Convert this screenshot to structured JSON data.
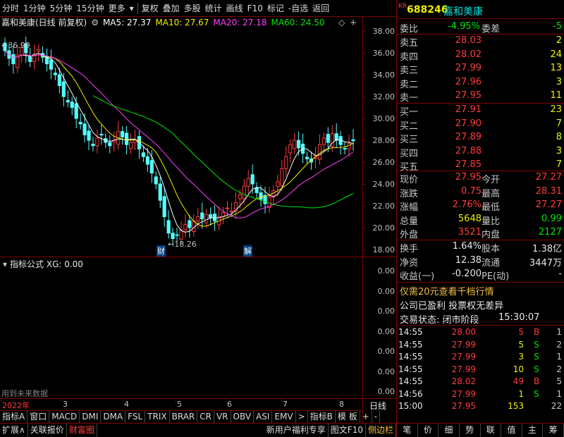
{
  "toolbar": {
    "items": [
      "分时",
      "1分钟",
      "5分钟",
      "15分钟",
      "更多",
      "复权",
      "叠加",
      "多股",
      "统计",
      "画线",
      "F10",
      "标记",
      "-自选",
      "返回"
    ]
  },
  "chart": {
    "title": "嘉和美康(日线 前复权)",
    "ma5": "MA5: 27.37",
    "ma10": "MA10: 27.67",
    "ma20": "MA20: 27.18",
    "ma60": "MA60: 24.50",
    "high_label": "36.99",
    "low_label": "18.26",
    "marker_cai": "财",
    "marker_jie": "解",
    "price_ticks": [
      "38.00",
      "36.00",
      "34.00",
      "32.00",
      "30.00",
      "28.00",
      "26.00",
      "24.00",
      "22.00",
      "20.00",
      "18.00"
    ],
    "indicator_title": "指标公式 XG: 0.00",
    "indicator_ticks": [
      "0.00",
      "0.00",
      "0.00",
      "0.00",
      "0.00",
      "0.00",
      "0.00"
    ],
    "future_data_note": "用到未来数据",
    "x_labels": [
      "2022年",
      "3",
      "4",
      "5",
      "6",
      "7",
      "8"
    ],
    "period_label": "日线",
    "colors": {
      "ma5": "#ffffff",
      "ma10": "#f0f000",
      "ma20": "#ff40ff",
      "ma60": "#00e600",
      "up": "#ff3c3c",
      "down": "#54ffff"
    }
  },
  "index_bar": {
    "items": [
      "指标A",
      "窗口",
      "MACD",
      "DMI",
      "DMA",
      "FSL",
      "TRIX",
      "BRAR",
      "CR",
      "VR",
      "OBV",
      "ASI",
      "EMV"
    ],
    "more": ">",
    "right_items": [
      "指标B",
      "模 板",
      "+",
      "-"
    ]
  },
  "bottom_bar": {
    "items": [
      "扩展∧",
      "关联报价",
      "财富圈"
    ],
    "right_items": [
      "新用户福利专享",
      "图文F10",
      "侧边栏"
    ]
  },
  "quote": {
    "code_prefix": "KR",
    "code": "688246",
    "name": "嘉和美康",
    "weibi_label": "委比",
    "weibi_value": "-4.95%",
    "weicha_label": "委差",
    "weicha_value": "-5",
    "sells": [
      {
        "label": "卖五",
        "price": "28.03",
        "vol": "2"
      },
      {
        "label": "卖四",
        "price": "28.02",
        "vol": "24"
      },
      {
        "label": "卖三",
        "price": "27.99",
        "vol": "13"
      },
      {
        "label": "卖二",
        "price": "27.96",
        "vol": "3"
      },
      {
        "label": "卖一",
        "price": "27.95",
        "vol": "11"
      }
    ],
    "buys": [
      {
        "label": "买一",
        "price": "27.91",
        "vol": "23"
      },
      {
        "label": "买二",
        "price": "27.90",
        "vol": "7"
      },
      {
        "label": "买三",
        "price": "27.89",
        "vol": "8"
      },
      {
        "label": "买四",
        "price": "27.88",
        "vol": "3"
      },
      {
        "label": "买五",
        "price": "27.85",
        "vol": "7"
      }
    ],
    "stats": [
      {
        "l1": "现价",
        "v1": "27.95",
        "l2": "今开",
        "v2": "27.27"
      },
      {
        "l1": "涨跌",
        "v1": "0.75",
        "l2": "最高",
        "v2": "28.31"
      },
      {
        "l1": "涨幅",
        "v1": "2.76%",
        "l2": "最低",
        "v2": "27.27"
      },
      {
        "l1": "总量",
        "v1": "5648",
        "l2": "量比",
        "v2": "0.99"
      },
      {
        "l1": "外盘",
        "v1": "3521",
        "l2": "内盘",
        "v2": "2127"
      }
    ],
    "stats2": [
      {
        "l1": "换手",
        "v1": "1.64%",
        "l2": "股本",
        "v2": "1.38亿"
      },
      {
        "l1": "净资",
        "v1": "12.38",
        "l2": "流通",
        "v2": "3447万"
      },
      {
        "l1": "收益(一)",
        "v1": "-0.200",
        "l2": "PE(动)",
        "v2": "-"
      }
    ],
    "promo": "仅需20元查看千档行情",
    "promo_highlight": "20",
    "notice": "公司已盈利 投票权无差异",
    "status_label": "交易状态: 闭市阶段",
    "status_time": "15:30:07",
    "ticks": [
      {
        "time": "14:55",
        "price": "28.00",
        "vol": "5",
        "dir": "B",
        "n": "1"
      },
      {
        "time": "14:55",
        "price": "27.99",
        "vol": "5",
        "dir": "S",
        "n": "2"
      },
      {
        "time": "14:55",
        "price": "27.99",
        "vol": "3",
        "dir": "S",
        "n": "1"
      },
      {
        "time": "14:55",
        "price": "27.99",
        "vol": "10",
        "dir": "S",
        "n": "2"
      },
      {
        "time": "14:55",
        "price": "28.02",
        "vol": "49",
        "dir": "B",
        "n": "5"
      },
      {
        "time": "14:56",
        "price": "27.99",
        "vol": "1",
        "dir": "S",
        "n": "1"
      },
      {
        "time": "15:00",
        "price": "27.95",
        "vol": "153",
        "dir": "",
        "n": "22"
      }
    ]
  },
  "right_bottom": {
    "items": [
      "笔",
      "价",
      "细",
      "势",
      "联",
      "值",
      "主",
      "筹"
    ]
  }
}
